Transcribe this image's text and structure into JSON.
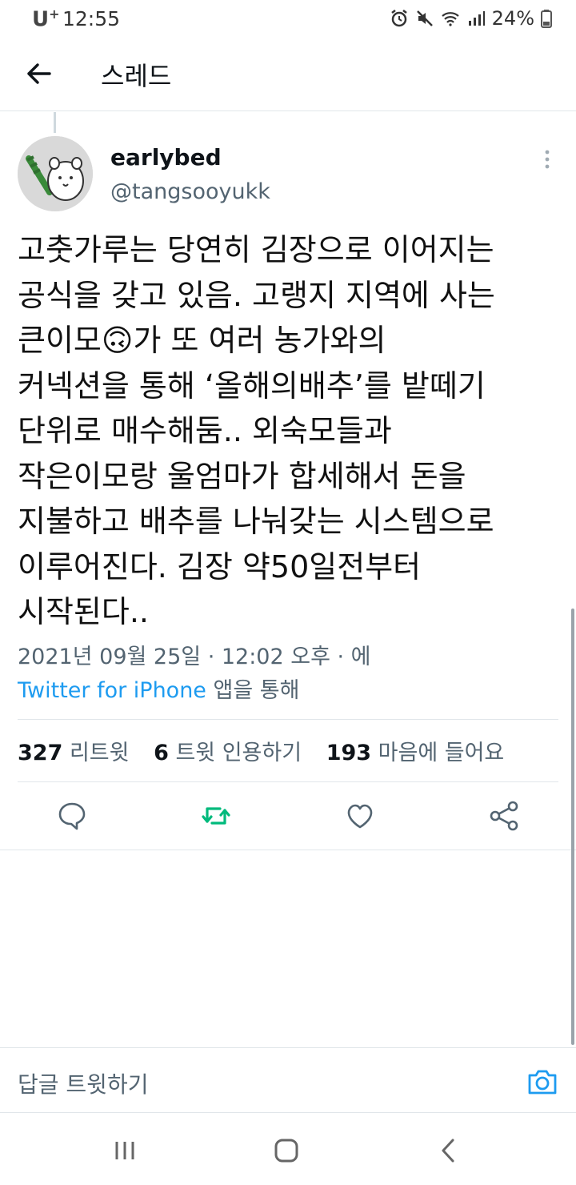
{
  "status_bar": {
    "carrier": "U",
    "carrier_sup": "+",
    "time": "12:55",
    "battery": "24%"
  },
  "appbar": {
    "title": "스레드"
  },
  "tweet": {
    "display_name": "earlybed",
    "handle": "@tangsooyukk",
    "text": "고춧가루는 당연히 김장으로 이어지는\n공식을 갖고 있음. 고랭지 지역에 사는\n큰이모🙃가 또 여러 농가와의\n커넥션을 통해 ‘올해의배추’를 밭떼기\n단위로 매수해둠.. 외숙모들과\n작은이모랑 울엄마가 합세해서 돈을\n지불하고 배추를 나눠갖는 시스템으로\n이루어진다. 김장 약50일전부터\n시작된다..",
    "timestamp": "2021년 09월 25일 · 12:02 오후 · 에",
    "source": "Twitter for iPhone",
    "source_suffix": " 앱을 통해"
  },
  "stats": {
    "retweets_count": "327",
    "retweets_label": " 리트윗",
    "quotes_count": "6",
    "quotes_label": " 트윗 인용하기",
    "likes_count": "193",
    "likes_label": " 마음에 들어요"
  },
  "reply_bar": {
    "placeholder": "답글 트윗하기"
  },
  "colors": {
    "accent": "#1d9bf0",
    "retweet_active": "#00ba7c",
    "muted": "#536471"
  },
  "icons": [
    "back-arrow-icon",
    "more-vertical-icon",
    "reply-icon",
    "retweet-icon",
    "like-icon",
    "share-icon",
    "camera-icon"
  ]
}
